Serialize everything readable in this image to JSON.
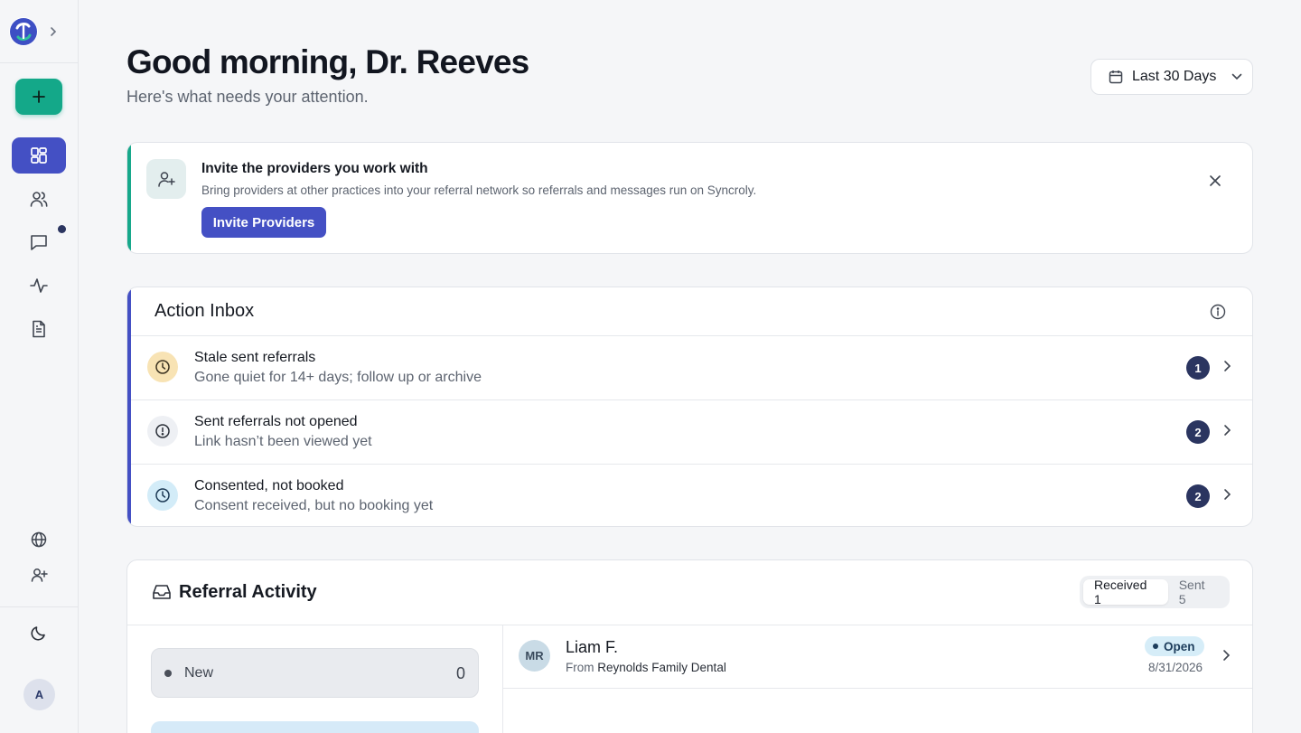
{
  "sidebar": {
    "logo": "syncroly-logo",
    "expand_icon": "chevron-right-icon",
    "new_button_icon": "plus-icon",
    "nav": [
      {
        "name": "dashboard",
        "icon": "grid-icon",
        "active": true
      },
      {
        "name": "providers",
        "icon": "users-icon",
        "active": false
      },
      {
        "name": "messages",
        "icon": "message-icon",
        "active": false,
        "unread": true
      },
      {
        "name": "activity",
        "icon": "pulse-icon",
        "active": false
      },
      {
        "name": "documents",
        "icon": "document-icon",
        "active": false
      }
    ],
    "bottom": [
      {
        "name": "network",
        "icon": "globe-icon"
      },
      {
        "name": "invite",
        "icon": "user-plus-icon"
      },
      {
        "name": "theme",
        "icon": "moon-icon"
      }
    ],
    "avatar_initial": "A"
  },
  "header": {
    "greeting": "Good morning, Dr. Reeves",
    "subtitle": "Here's what needs your attention.",
    "date_range": "Last 30 Days"
  },
  "invite_banner": {
    "title": "Invite the providers you work with",
    "description": "Bring providers at other practices into your referral network so referrals and messages run on Syncroly.",
    "button": "Invite Providers"
  },
  "action_inbox": {
    "title": "Action Inbox",
    "items": [
      {
        "title": "Stale sent referrals",
        "subtitle": "Gone quiet for 14+ days; follow up or archive",
        "count": "1",
        "icon": "clock-icon",
        "icon_bg": "#f8e3b4"
      },
      {
        "title": "Sent referrals not opened",
        "subtitle": "Link hasn’t been viewed yet",
        "count": "2",
        "icon": "alert-circle-icon",
        "icon_bg": "#eef0f4"
      },
      {
        "title": "Consented, not booked",
        "subtitle": "Consent received, but no booking yet",
        "count": "2",
        "icon": "clock-icon",
        "icon_bg": "#d3ecf8"
      }
    ]
  },
  "referral_activity": {
    "title": "Referral Activity",
    "tabs": [
      {
        "label": "Received 1",
        "active": true
      },
      {
        "label": "Sent 5",
        "active": false
      }
    ],
    "status_new": {
      "label": "New",
      "count": "0"
    },
    "referral": {
      "initials": "MR",
      "name": "Liam F.",
      "from_label": "From",
      "from_practice": "Reynolds Family Dental",
      "status": "Open",
      "date": "8/31/2026"
    }
  },
  "colors": {
    "accent": "#4450c4",
    "teal": "#14a889",
    "badge": "#2b3560"
  }
}
